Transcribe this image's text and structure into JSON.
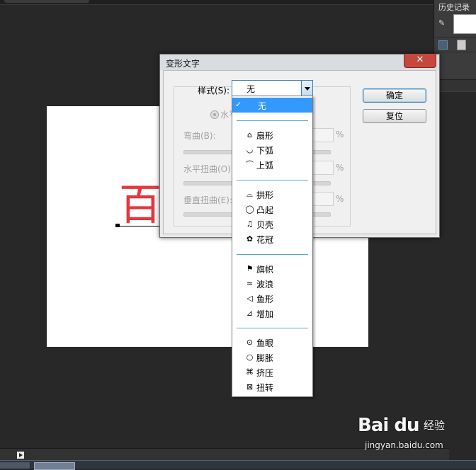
{
  "history_panel": {
    "title": "历史记录"
  },
  "dialog": {
    "title": "变形文字",
    "close_glyph": "✕",
    "style_label": "样式(S):",
    "style_value": "无",
    "orientation_label": "水平",
    "bend_label": "弯曲(B):",
    "h_distortion_label": "水平扭曲(O):",
    "v_distortion_label": "垂直扭曲(E):",
    "percent": "%",
    "ok_button": "确定",
    "reset_button": "复位"
  },
  "dropdown": {
    "selected": "无",
    "check_glyph": "✓",
    "groups": [
      [
        {
          "label": "扇形",
          "icon": "arc-icon"
        },
        {
          "label": "下弧",
          "icon": "arc-lower-icon"
        },
        {
          "label": "上弧",
          "icon": "arc-upper-icon"
        }
      ],
      [
        {
          "label": "拱形",
          "icon": "arch-icon"
        },
        {
          "label": "凸起",
          "icon": "bulge-icon"
        },
        {
          "label": "贝壳",
          "icon": "shell-icon"
        },
        {
          "label": "花冠",
          "icon": "flower-icon"
        }
      ],
      [
        {
          "label": "旗帜",
          "icon": "flag-icon"
        },
        {
          "label": "波浪",
          "icon": "wave-icon"
        },
        {
          "label": "鱼形",
          "icon": "fish-icon"
        },
        {
          "label": "增加",
          "icon": "rise-icon"
        }
      ],
      [
        {
          "label": "鱼眼",
          "icon": "fisheye-icon"
        },
        {
          "label": "膨胀",
          "icon": "inflate-icon"
        },
        {
          "label": "挤压",
          "icon": "squeeze-icon"
        },
        {
          "label": "扭转",
          "icon": "twist-icon"
        }
      ]
    ]
  },
  "canvas": {
    "text": "百",
    "text_color": "#e8353c"
  },
  "watermark": {
    "logo": "Bai du",
    "cn": "经验",
    "url": "jingyan.baidu.com"
  }
}
